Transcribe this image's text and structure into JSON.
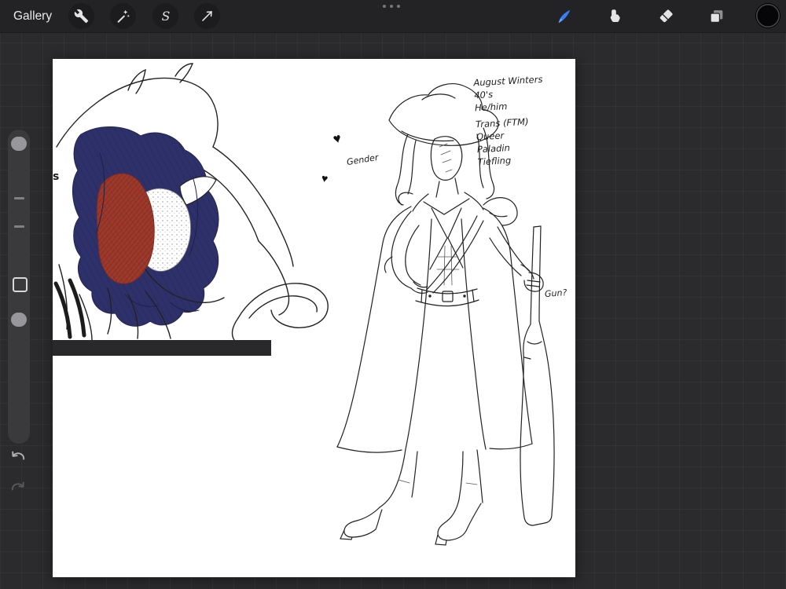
{
  "toolbar": {
    "gallery_label": "Gallery",
    "selection_glyph": "S",
    "accent_color": "#3a7cf7",
    "current_color": "#060608"
  },
  "canvas_notes": {
    "lines": [
      "August Winters",
      "40's",
      "He/him",
      "Trans (FTM)",
      "Queer",
      "Paladin",
      "Tiefling"
    ],
    "gender_label": "Gender",
    "gun_label": "Gun?",
    "edge_letter": "s",
    "heart_glyph": "♥"
  },
  "artwork_colors": {
    "hair": "#2e3169",
    "skin": "#9d392c",
    "dark_bar": "#29292b"
  }
}
